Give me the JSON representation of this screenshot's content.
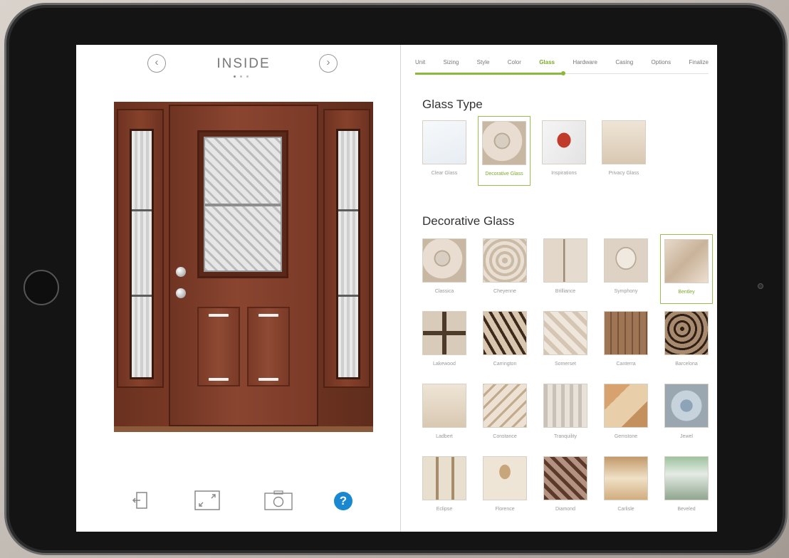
{
  "left": {
    "view_title": "INSIDE",
    "prev_glyph": "‹",
    "next_glyph": "›",
    "help_glyph": "?"
  },
  "steps": [
    {
      "label": "Unit"
    },
    {
      "label": "Sizing"
    },
    {
      "label": "Style"
    },
    {
      "label": "Color"
    },
    {
      "label": "Glass",
      "active": true
    },
    {
      "label": "Hardware"
    },
    {
      "label": "Casing"
    },
    {
      "label": "Options"
    },
    {
      "label": "Finalize"
    }
  ],
  "glass_type": {
    "title": "Glass Type",
    "options": [
      {
        "label": "Clear Glass",
        "texture": "tex-clear"
      },
      {
        "label": "Decorative Glass",
        "texture": "tex-a",
        "selected": true
      },
      {
        "label": "Inspirations",
        "texture": "tex-u"
      },
      {
        "label": "Privacy Glass",
        "texture": "tex-k"
      }
    ]
  },
  "decorative_glass": {
    "title": "Decorative Glass",
    "options": [
      {
        "label": "Classica",
        "texture": "tex-a"
      },
      {
        "label": "Cheyenne",
        "texture": "tex-b"
      },
      {
        "label": "Brilliance",
        "texture": "tex-c"
      },
      {
        "label": "Symphony",
        "texture": "tex-h"
      },
      {
        "label": "Bentley",
        "texture": "tex-e",
        "selected": true
      },
      {
        "label": "Lakewood",
        "texture": "tex-f"
      },
      {
        "label": "Carrington",
        "texture": "tex-g"
      },
      {
        "label": "Somerset",
        "texture": "tex-d"
      },
      {
        "label": "Canterra",
        "texture": "tex-i"
      },
      {
        "label": "Barcelona",
        "texture": "tex-j"
      },
      {
        "label": "Ladbert",
        "texture": "tex-k"
      },
      {
        "label": "Constance",
        "texture": "tex-l"
      },
      {
        "label": "Tranquility",
        "texture": "tex-m"
      },
      {
        "label": "Gemstone",
        "texture": "tex-n"
      },
      {
        "label": "Jewel",
        "texture": "tex-o"
      },
      {
        "label": "Eclipse",
        "texture": "tex-p"
      },
      {
        "label": "Florence",
        "texture": "tex-q"
      },
      {
        "label": "Diamond",
        "texture": "tex-r"
      },
      {
        "label": "Carlisle",
        "texture": "tex-s"
      },
      {
        "label": "Beveled",
        "texture": "tex-t"
      }
    ]
  },
  "colors": {
    "accent": "#7cab2c",
    "help_button": "#1a88d0",
    "door_wood": "#7c3b26"
  }
}
